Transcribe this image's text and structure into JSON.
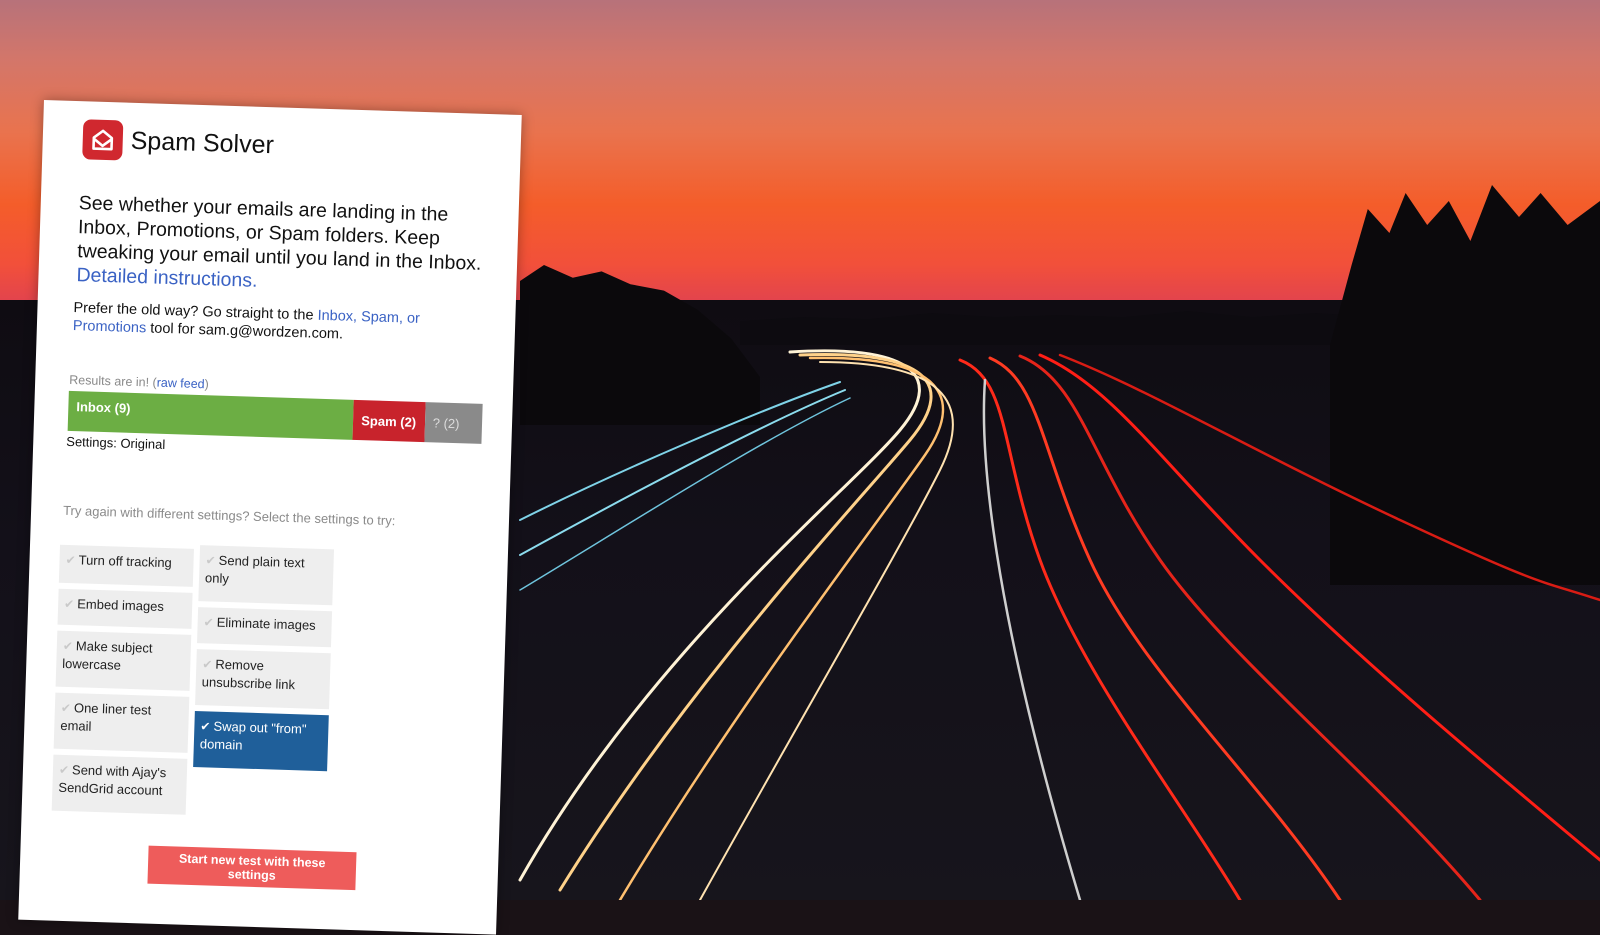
{
  "app": {
    "title": "Spam Solver",
    "logo_icon": "envelope-logo-icon",
    "brand_color": "#d0282f"
  },
  "intro": {
    "text": "See whether your emails are landing in the Inbox, Promotions, or Spam folders. Keep tweaking your email until you land in the Inbox. ",
    "link": "Detailed instructions."
  },
  "old_way": {
    "prefix": "Prefer the old way? Go straight to the ",
    "link": "Inbox, Spam, or Promotions",
    "suffix": " tool for sam.g@wordzen.com."
  },
  "results": {
    "label": "Results are in! (",
    "raw_feed_link": "raw feed",
    "label_suffix": ")",
    "segments": [
      {
        "label": "Inbox (9)",
        "count": 9,
        "color": "#6cae44"
      },
      {
        "label": "Spam (2)",
        "count": 2,
        "color": "#c8232c"
      },
      {
        "label": "? (2)",
        "count": 2,
        "color": "#8a8a8a"
      }
    ],
    "settings_line": "Settings: Original"
  },
  "retry": {
    "prompt": "Try again with different settings? Select the settings to try:",
    "options": [
      {
        "label": "Turn off tracking",
        "selected": false
      },
      {
        "label": "Send plain text only",
        "selected": false
      },
      {
        "label": "Embed images",
        "selected": false
      },
      {
        "label": "Eliminate images",
        "selected": false
      },
      {
        "label": "Make subject lowercase",
        "selected": false
      },
      {
        "label": "Remove unsubscribe link",
        "selected": false
      },
      {
        "label": "One liner test email",
        "selected": false
      },
      {
        "label": "Swap out \"from\" domain",
        "selected": true
      },
      {
        "label": "Send with Ajay's SendGrid account",
        "selected": false
      }
    ],
    "check_glyph": "✔",
    "start_button": "Start new test with these settings"
  }
}
